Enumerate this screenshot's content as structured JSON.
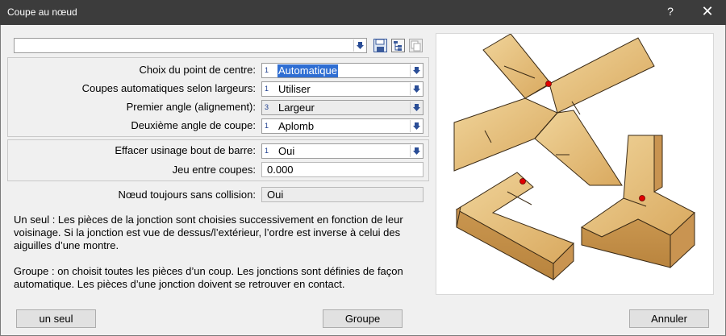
{
  "window": {
    "title": "Coupe au nœud",
    "help_label": "?",
    "close_label": "✕"
  },
  "top_combo": {
    "value": ""
  },
  "fields": [
    {
      "label": "Choix du point de centre:",
      "num": "1",
      "value": "Automatique",
      "selected": true
    },
    {
      "label": "Coupes automatiques selon largeurs:",
      "num": "1",
      "value": "Utiliser",
      "selected": false
    },
    {
      "label": "Premier angle (alignement):",
      "num": "3",
      "value": "Largeur",
      "selected": false
    },
    {
      "label": "Deuxième angle de coupe:",
      "num": "1",
      "value": "Aplomb",
      "selected": false
    }
  ],
  "group2": {
    "effacer": {
      "label": "Effacer usinage bout de barre:",
      "num": "1",
      "value": "Oui"
    },
    "jeu": {
      "label": "Jeu entre coupes:",
      "value": "0.000"
    }
  },
  "noeud": {
    "label": "Nœud toujours sans collision:",
    "value": "Oui"
  },
  "description": {
    "p1": "Un seul : Les pièces de la jonction sont choisies successivement en fonction de leur voisinage. Si la jonction est vue de dessus/l’extérieur, l’ordre est inverse à celui des aiguilles d’une montre.",
    "p2": "Groupe : on choisit toutes les pièces d’un coup. Les jonctions sont définies de façon automatique. Les pièces d’une jonction doivent se retrouver en contact."
  },
  "buttons": {
    "un_seul": "un seul",
    "groupe": "Groupe",
    "annuler": "Annuler"
  },
  "colors": {
    "titlebar": "#3c3c3c",
    "selection": "#2f6ed3",
    "wood": "#e6bf7e",
    "marker": "#e00000"
  }
}
